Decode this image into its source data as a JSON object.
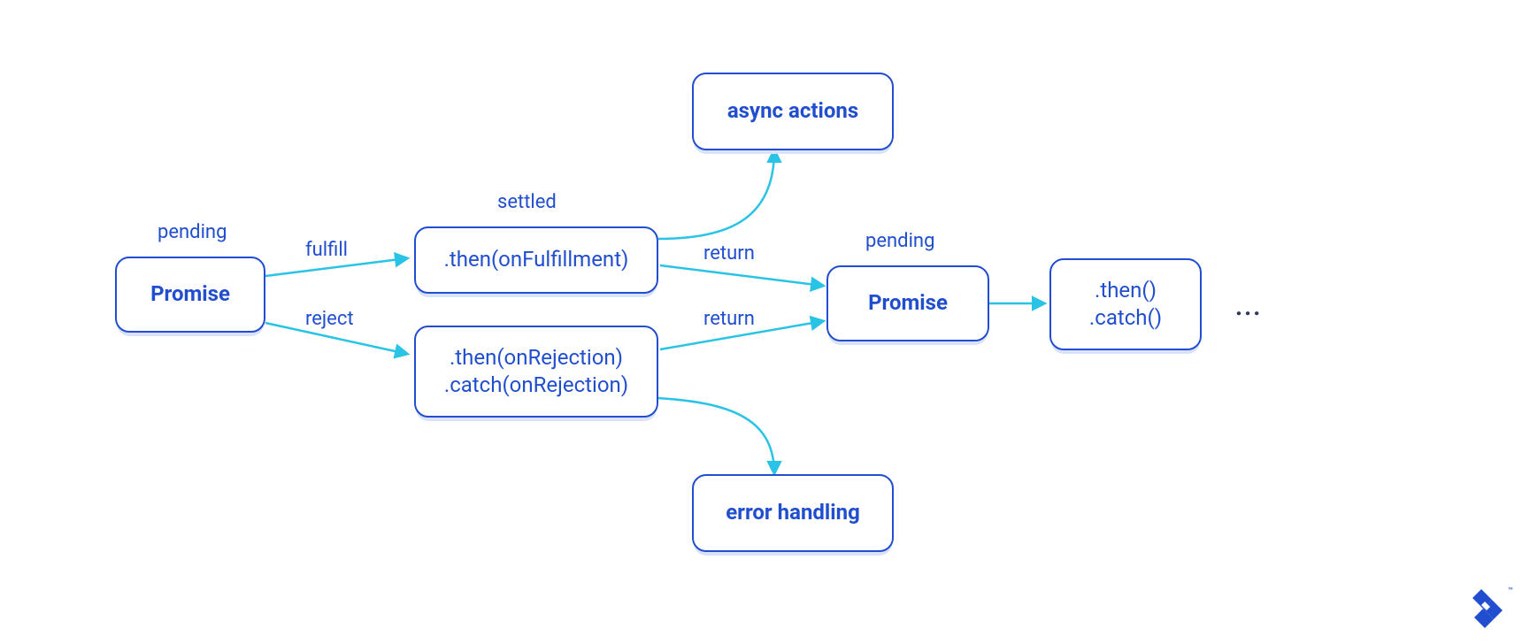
{
  "colors": {
    "node_border": "#204ecf",
    "node_text": "#204ecf",
    "node_shadow": "#d9e2f8",
    "arrow": "#29c3e5"
  },
  "nodes": {
    "promise1": {
      "title": "Promise",
      "state_label": "pending"
    },
    "then_fulfill": {
      "title": ".then(onFulfillment)",
      "state_label": "settled"
    },
    "then_reject": {
      "line1": ".then(onRejection)",
      "line2": ".catch(onRejection)"
    },
    "async_actions": {
      "title": "async actions"
    },
    "error_handling": {
      "title": "error handling"
    },
    "promise2": {
      "title": "Promise",
      "state_label": "pending"
    },
    "then_catch": {
      "line1": ".then()",
      "line2": ".catch()"
    }
  },
  "edges": {
    "fulfill": "fulfill",
    "reject": "reject",
    "return1": "return",
    "return2": "return"
  },
  "ellipsis": "...",
  "trademark": "™"
}
